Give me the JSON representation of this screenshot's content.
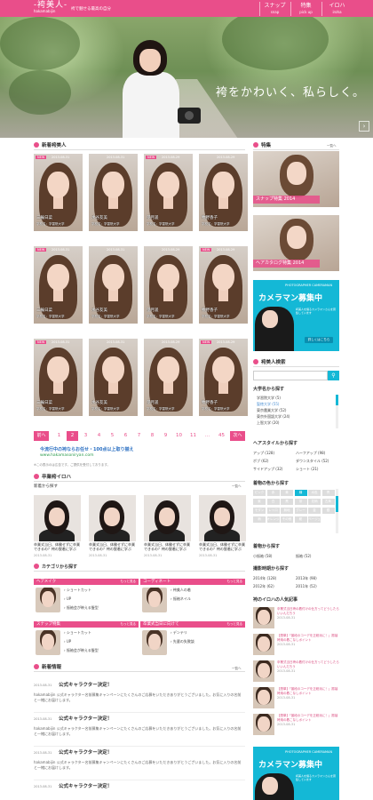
{
  "site": {
    "logo": "-袴美人-",
    "logo_sub": "hakamabijin",
    "tagline": "袴で魅せる最高の自分",
    "nav": [
      {
        "label": "スナップ",
        "sub": "snap"
      },
      {
        "label": "特集",
        "sub": "pick up"
      },
      {
        "label": "イロハ",
        "sub": "iroha"
      }
    ]
  },
  "hero": {
    "copy": "袴をかわいく、私らしく。"
  },
  "new_beauties": {
    "heading": "新着袴美人",
    "cards": [
      {
        "new": "NEW",
        "date": "2013-08-31",
        "name": "三輪日菜",
        "school": "学校名：学習院大学"
      },
      {
        "new": "",
        "date": "2013-08-31",
        "name": "水谷友美",
        "school": "学校名：学習院大学"
      },
      {
        "new": "NEW",
        "date": "2013-08-29",
        "name": "望月遥",
        "school": "学校名：学習院大学"
      },
      {
        "new": "",
        "date": "2013-08-29",
        "name": "牧野香子",
        "school": "学校名：学習院大学"
      },
      {
        "new": "NEW",
        "date": "2013-08-31",
        "name": "三輪日菜",
        "school": "学校名：学習院大学"
      },
      {
        "new": "",
        "date": "2013-08-31",
        "name": "水谷友美",
        "school": "学校名：学習院大学"
      },
      {
        "new": "",
        "date": "2013-08-29",
        "name": "望月遥",
        "school": "学校名：学習院大学"
      },
      {
        "new": "NEW",
        "date": "2013-08-29",
        "name": "牧野香子",
        "school": "学校名：学習院大学"
      },
      {
        "new": "NEW",
        "date": "2013-08-31",
        "name": "三輪日菜",
        "school": "学校名：学習院大学"
      },
      {
        "new": "",
        "date": "2013-08-31",
        "name": "水谷友美",
        "school": "学校名：学習院大学"
      },
      {
        "new": "",
        "date": "2013-08-29",
        "name": "望月遥",
        "school": "学校名：学習院大学"
      },
      {
        "new": "NEW",
        "date": "2013-08-29",
        "name": "牧野香子",
        "school": "学校名：学習院大学"
      }
    ],
    "pagination": {
      "prev": "前へ",
      "pages": [
        "1",
        "2",
        "3",
        "4",
        "5",
        "6",
        "7",
        "8",
        "9",
        "10",
        "11",
        "...",
        "45"
      ],
      "current": "2",
      "next": "次へ"
    },
    "campaign_title": "今流行中の袴ならお任せ・100点以上取り揃え",
    "campaign_url": "www.hakamasoniryan.com",
    "note": "※この表示のは広告です。ご提供を受付しております。"
  },
  "graduate": {
    "heading": "卒業袴イロハ",
    "sub": "新着から探す",
    "more": "一覧へ",
    "items": [
      {
        "title": "卒業式当日、体験せずに卒業できるの？袴の脱着に学ぶ",
        "date": "2013-08-31"
      },
      {
        "title": "卒業式当日、体験せずに卒業できるの？袴の脱着に学ぶ",
        "date": "2013-08-31"
      },
      {
        "title": "卒業式当日、体験せずに卒業できるの？袴の脱着に学ぶ",
        "date": "2013-08-31"
      },
      {
        "title": "卒業式当日、体験せずに卒業できるの？袴の脱着に学ぶ",
        "date": "2013-08-31"
      }
    ],
    "category_heading": "カテゴリから探す",
    "categories": [
      {
        "title": "ヘアメイク",
        "more": "もっと見る",
        "items": [
          "ショートカット",
          "UP",
          "振袖会が映える髪型"
        ]
      },
      {
        "title": "コーディネート",
        "more": "もっと見る",
        "items": [
          "袴美人の着",
          "振袖ネイル"
        ]
      },
      {
        "title": "スナップ特集",
        "more": "もっと見る",
        "items": [
          "ショートカット",
          "UP",
          "振袖会が映える髪型"
        ]
      },
      {
        "title": "卒業式当日に向けて",
        "more": "もっと見る",
        "items": [
          "デンテリ",
          "先輩の失敗談"
        ]
      }
    ]
  },
  "news": {
    "heading": "新着情報",
    "more": "一覧へ",
    "items": [
      {
        "date": "2013-08-31",
        "title": "公式キャラクター決定！",
        "body": "hakamabijin 公式キャラクター名前募集キャンペーンにたくさんのご応募をいただきありがとうございました。お気に入りの名前と一緒にお届けします。"
      },
      {
        "date": "2013-08-31",
        "title": "公式キャラクター決定！",
        "body": "hakamabijin 公式キャラクター名前募集キャンペーンにたくさんのご応募をいただきありがとうございました。お気に入りの名前と一緒にお届けします。"
      },
      {
        "date": "2013-08-31",
        "title": "公式キャラクター決定！",
        "body": "hakamabijin 公式キャラクター名前募集キャンペーンにたくさんのご応募をいただきありがとうございました。お気に入りの名前と一緒にお届けします。"
      },
      {
        "date": "2013-08-31",
        "title": "公式キャラクター決定！",
        "body": ""
      }
    ]
  },
  "sidebar": {
    "feature_heading": "特集",
    "feature_more": "一覧へ",
    "features": [
      {
        "label": "スナップ特集 2014"
      },
      {
        "label": "ヘアカタログ特集 2014"
      }
    ],
    "camera_banner": {
      "small": "PHOTOGRAPHER CAMERAMAN",
      "title": "カメラマン募集中",
      "desc": "袴美人を撮るカメラマンさんを募集しています",
      "button": "詳しくはこちら"
    },
    "search_heading": "袴美人検索",
    "search_placeholder": "",
    "univ_heading": "大学名から探す",
    "univs": [
      "学習院大学 (5)",
      "聖徳大学 (55)",
      "東京農業大学 (52)",
      "東京外国語大学 (24)",
      "上智大学 (20)"
    ],
    "hair_heading": "ヘアスタイルから探す",
    "hair": [
      "アップ (128)",
      "ハーフアップ (98)",
      "ボブ (62)",
      "ダウンスタイル (52)",
      "サイドアップ (32)",
      "ショート (21)"
    ],
    "color_heading": "着物の色から探す",
    "color_chips": [
      "ピンク",
      "赤",
      "黄",
      "緑",
      "水色",
      "青",
      "紫",
      "白",
      "黒",
      "茶",
      "花柄",
      "古典",
      "モダン",
      "レトロ",
      "無地",
      "グレー",
      "金",
      "銀",
      "柄",
      "オレンジ",
      "その他",
      "紺",
      "ベージュ"
    ],
    "kimono_heading": "着物から探す",
    "kimono": [
      "小振袖 (58)",
      "振袖 (52)"
    ],
    "year_heading": "撮影時期から探す",
    "years": [
      "2014年 (128)",
      "2013年 (98)",
      "2012年 (62)",
      "2011年 (52)"
    ],
    "iroha_heading": "袴のイロハの人気記事",
    "iroha": [
      {
        "title": "卒業式当日袴の着付けの仕方ってどうしたらいいんだろう",
        "date": "2013-08-31"
      },
      {
        "title": "【簡単】「普段のコーデを正統派に！」振袖袴用の着こなしポイント",
        "date": "2013-08-31"
      },
      {
        "title": "卒業式当日袴の着付けの仕方ってどうしたらいいんだろう",
        "date": "2013-08-31"
      },
      {
        "title": "【簡単】「普段のコーデを正統派に！」振袖袴用の着こなしポイント",
        "date": "2013-08-31"
      },
      {
        "title": "【簡単】「普段のコーデを正統派に！」振袖袴用の着こなしポイント",
        "date": "2013-08-31"
      }
    ]
  },
  "colors": {
    "accent": "#e94e8a",
    "cyan": "#14b8d6"
  }
}
